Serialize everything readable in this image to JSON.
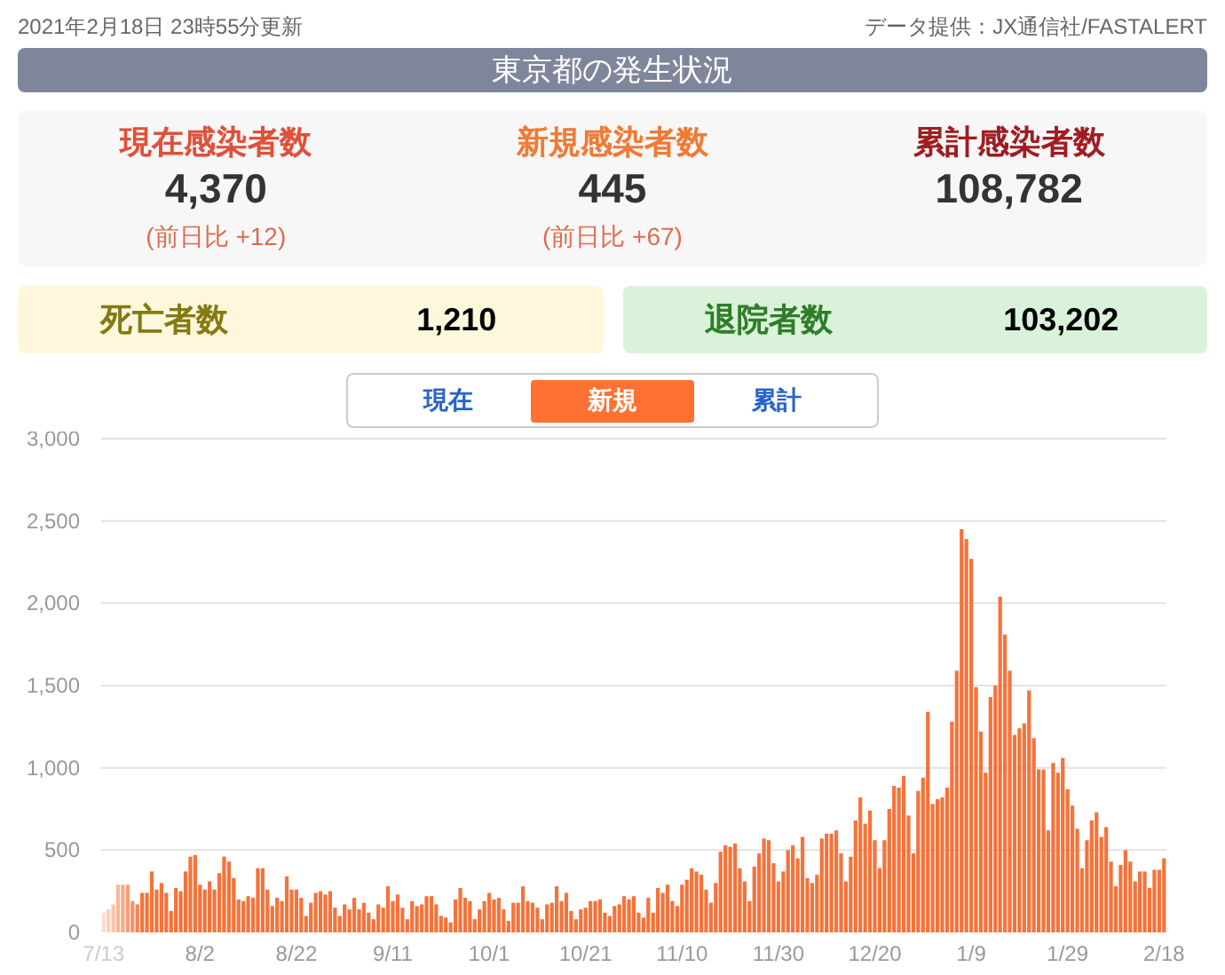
{
  "header": {
    "updated": "2021年2月18日 23時55分更新",
    "source": "データ提供：JX通信社/FASTALERT"
  },
  "title": "東京都の発生状況",
  "stats": [
    {
      "kind": "current",
      "label": "現在感染者数",
      "value": "4,370",
      "diff": "(前日比 +12)"
    },
    {
      "kind": "new",
      "label": "新規感染者数",
      "value": "445",
      "diff": "(前日比 +67)"
    },
    {
      "kind": "total",
      "label": "累計感染者数",
      "value": "108,782"
    }
  ],
  "outcomes": [
    {
      "kind": "deaths",
      "label": "死亡者数",
      "value": "1,210"
    },
    {
      "kind": "discharged",
      "label": "退院者数",
      "value": "103,202"
    }
  ],
  "tabs": [
    {
      "label": "現在",
      "selected": false
    },
    {
      "label": "新規",
      "selected": true
    },
    {
      "label": "累計",
      "selected": false
    }
  ],
  "chart_data": {
    "type": "bar",
    "categories": [
      "7/13",
      null,
      null,
      null,
      null,
      null,
      null,
      null,
      null,
      null,
      null,
      null,
      null,
      null,
      null,
      null,
      null,
      null,
      null,
      null,
      "8/2",
      null,
      null,
      null,
      null,
      null,
      null,
      null,
      null,
      null,
      null,
      null,
      null,
      null,
      null,
      null,
      null,
      null,
      null,
      null,
      "8/22",
      null,
      null,
      null,
      null,
      null,
      null,
      null,
      null,
      null,
      null,
      null,
      null,
      null,
      null,
      null,
      null,
      null,
      null,
      null,
      "9/11",
      null,
      null,
      null,
      null,
      null,
      null,
      null,
      null,
      null,
      null,
      null,
      null,
      null,
      null,
      null,
      null,
      null,
      null,
      null,
      "10/1",
      null,
      null,
      null,
      null,
      null,
      null,
      null,
      null,
      null,
      null,
      null,
      null,
      null,
      null,
      null,
      null,
      null,
      null,
      null,
      "10/21",
      null,
      null,
      null,
      null,
      null,
      null,
      null,
      null,
      null,
      null,
      null,
      null,
      null,
      null,
      null,
      null,
      null,
      null,
      null,
      "11/10",
      null,
      null,
      null,
      null,
      null,
      null,
      null,
      null,
      null,
      null,
      null,
      null,
      null,
      null,
      null,
      null,
      null,
      null,
      null,
      "11/30",
      null,
      null,
      null,
      null,
      null,
      null,
      null,
      null,
      null,
      null,
      null,
      null,
      null,
      null,
      null,
      null,
      null,
      null,
      null,
      "12/20",
      null,
      null,
      null,
      null,
      null,
      null,
      null,
      null,
      null,
      null,
      null,
      null,
      null,
      null,
      null,
      null,
      null,
      null,
      null,
      "1/9",
      null,
      null,
      null,
      null,
      null,
      null,
      null,
      null,
      null,
      null,
      null,
      null,
      null,
      null,
      null,
      null,
      null,
      null,
      null,
      "1/29",
      null,
      null,
      null,
      null,
      null,
      null,
      null,
      null,
      null,
      null,
      null,
      null,
      null,
      null,
      null,
      null,
      null,
      null,
      null,
      "2/18"
    ],
    "series": [
      {
        "color": "#f4733a",
        "values": [
          120,
          140,
          170,
          290,
          290,
          290,
          190,
          170,
          240,
          240,
          370,
          260,
          300,
          240,
          130,
          270,
          250,
          370,
          460,
          470,
          290,
          260,
          310,
          260,
          360,
          460,
          430,
          330,
          200,
          190,
          220,
          210,
          390,
          390,
          260,
          160,
          210,
          190,
          340,
          260,
          260,
          210,
          100,
          180,
          240,
          250,
          230,
          250,
          150,
          100,
          170,
          140,
          210,
          140,
          180,
          120,
          80,
          170,
          150,
          280,
          190,
          230,
          150,
          80,
          190,
          160,
          170,
          220,
          220,
          170,
          100,
          90,
          60,
          200,
          270,
          210,
          190,
          80,
          140,
          190,
          240,
          200,
          210,
          140,
          70,
          180,
          180,
          280,
          190,
          180,
          150,
          80,
          170,
          180,
          280,
          190,
          240,
          130,
          80,
          140,
          150,
          190,
          190,
          200,
          120,
          100,
          160,
          170,
          220,
          200,
          220,
          120,
          90,
          210,
          120,
          270,
          240,
          290,
          190,
          160,
          290,
          320,
          390,
          370,
          350,
          260,
          180,
          300,
          490,
          530,
          520,
          540,
          390,
          310,
          190,
          400,
          480,
          570,
          560,
          420,
          310,
          370,
          500,
          530,
          450,
          580,
          330,
          300,
          350,
          570,
          600,
          600,
          620,
          480,
          310,
          460,
          680,
          820,
          660,
          740,
          560,
          390,
          560,
          750,
          890,
          880,
          950,
          710,
          480,
          860,
          940,
          1340,
          780,
          810,
          820,
          880,
          1280,
          1590,
          2450,
          2390,
          2270,
          1490,
          1220,
          970,
          1430,
          1500,
          2040,
          1810,
          1590,
          1200,
          1240,
          1270,
          1470,
          1180,
          990,
          990,
          620,
          1030,
          970,
          1060,
          870,
          770,
          630,
          390,
          560,
          680,
          730,
          580,
          640,
          430,
          280,
          410,
          500,
          430,
          310,
          370,
          370,
          270,
          380,
          380,
          450
        ]
      }
    ],
    "ylim": [
      0,
      3000
    ],
    "grid": true,
    "yticks": [
      {
        "value": 0,
        "label": "0"
      },
      {
        "value": 500,
        "label": "500"
      },
      {
        "value": 1000,
        "label": "1,000"
      },
      {
        "value": 1500,
        "label": "1,500"
      },
      {
        "value": 2000,
        "label": "2,000"
      },
      {
        "value": 2500,
        "label": "2,500"
      },
      {
        "value": 3000,
        "label": "3,000"
      }
    ]
  }
}
